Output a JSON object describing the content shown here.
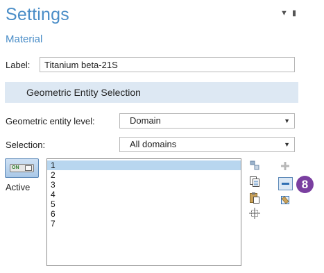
{
  "header": {
    "title": "Settings",
    "subtitle": "Material"
  },
  "label_field": {
    "label": "Label:",
    "value": "Titanium beta-21S"
  },
  "section": {
    "title": "Geometric Entity Selection"
  },
  "entity_level": {
    "label": "Geometric entity level:",
    "value": "Domain"
  },
  "selection": {
    "label": "Selection:",
    "value": "All domains"
  },
  "active": {
    "toggle_text": "ON",
    "label": "Active"
  },
  "domains": {
    "items": [
      "1",
      "2",
      "3",
      "4",
      "5",
      "6",
      "7"
    ],
    "selected": "1"
  },
  "callout": {
    "number": "8"
  },
  "colors": {
    "accent": "#4a8dc7",
    "section_bg": "#dde8f3",
    "selection": "#b8d6ef",
    "callout": "#7a3fa0"
  },
  "icons": [
    "pane-menu-icon",
    "pin-icon",
    "paste-selection-icon",
    "copy-selection-icon",
    "paste-icon",
    "zoom-to-selection-icon",
    "add-icon",
    "remove-icon",
    "clear-selection-icon"
  ]
}
